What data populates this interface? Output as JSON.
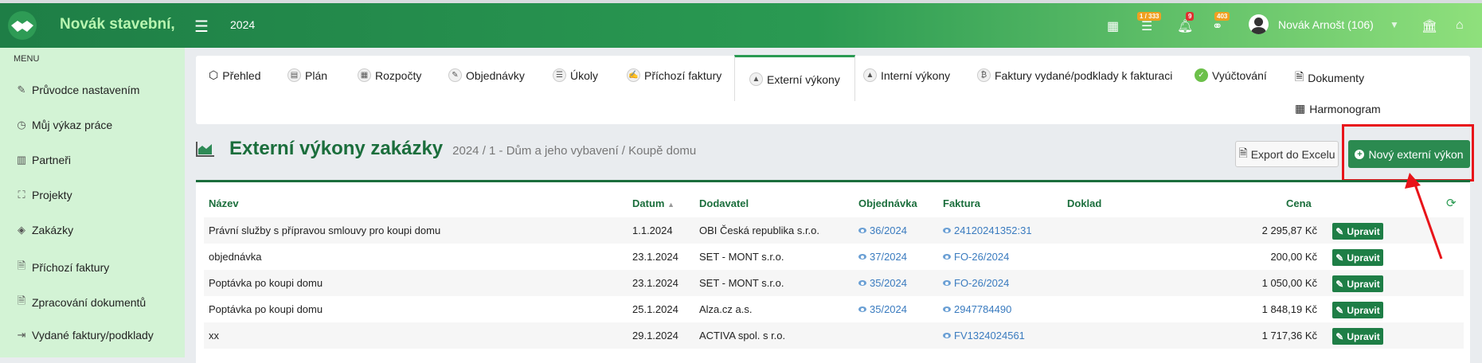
{
  "brand": "Novák stavební,",
  "year": "2024",
  "badges": {
    "tasks": "1 / 333",
    "notifications": "9",
    "other": "403"
  },
  "user": {
    "name": "Novák Arnošt (106)"
  },
  "sidebar": {
    "menu_label": "MENU",
    "items": [
      {
        "label": "Průvodce nastavením",
        "icon": "pencil-icon"
      },
      {
        "label": "Můj výkaz práce",
        "icon": "clock-icon"
      },
      {
        "label": "Partneři",
        "icon": "building-icon"
      },
      {
        "label": "Projekty",
        "icon": "cubes-icon"
      },
      {
        "label": "Zakázky",
        "icon": "cube-icon"
      },
      {
        "label": "Příchozí faktury",
        "icon": "document-icon"
      },
      {
        "label": "Zpracování dokumentů",
        "icon": "document-icon"
      },
      {
        "label": "Vydané faktury/podklady",
        "icon": "export-icon"
      }
    ]
  },
  "tabs": [
    "Přehled",
    "Plán",
    "Rozpočty",
    "Objednávky",
    "Úkoly",
    "Příchozí faktury",
    "Externí výkony",
    "Interní výkony",
    "Faktury vydané/podklady k fakturaci",
    "Vyúčtování",
    "Dokumenty",
    "Harmonogram"
  ],
  "page": {
    "title": "Externí výkony zakázky",
    "breadcrumb": "2024 / 1 - Dům a jeho vybavení / Koupě domu",
    "export_label": "Export do Excelu",
    "new_label": "Nový externí výkon"
  },
  "table": {
    "headers": [
      "Název",
      "Datum",
      "Dodavatel",
      "Objednávka",
      "Faktura",
      "Doklad",
      "Cena"
    ],
    "edit_label": "Upravit",
    "rows": [
      {
        "nazev": "Právní služby s přípravou smlouvy pro koupi domu",
        "datum": "1.1.2024",
        "dodavatel": "OBI Česká republika s.r.o.",
        "objednavka": "36/2024",
        "faktura": "24120241352:31",
        "cena": "2 295,87 Kč"
      },
      {
        "nazev": "objednávka",
        "datum": "23.1.2024",
        "dodavatel": "SET - MONT s.r.o.",
        "objednavka": "37/2024",
        "faktura": "FO-26/2024",
        "cena": "200,00 Kč"
      },
      {
        "nazev": "Poptávka po koupi domu",
        "datum": "23.1.2024",
        "dodavatel": "SET - MONT s.r.o.",
        "objednavka": "35/2024",
        "faktura": "FO-26/2024",
        "cena": "1 050,00 Kč"
      },
      {
        "nazev": "Poptávka po koupi domu",
        "datum": "25.1.2024",
        "dodavatel": "Alza.cz a.s.",
        "objednavka": "35/2024",
        "faktura": "2947784490",
        "cena": "1 848,19 Kč"
      },
      {
        "nazev": "xx",
        "datum": "29.1.2024",
        "dodavatel": "ACTIVA spol. s r.o.",
        "objednavka": "",
        "faktura": "FV1324024561",
        "cena": "1 717,36 Kč"
      }
    ]
  },
  "colors": {
    "brand_green": "#1e7e46",
    "highlight_red": "#e8141a",
    "link_blue": "#3a7bbf"
  }
}
